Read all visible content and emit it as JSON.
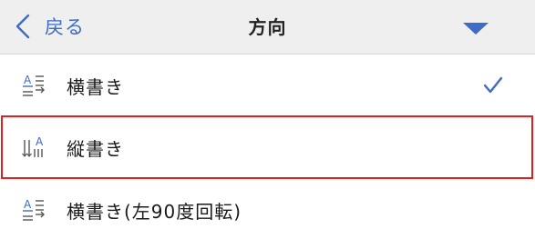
{
  "nav": {
    "back_label": "戻る",
    "title": "方向"
  },
  "options": [
    {
      "label": "横書き",
      "icon": "horizontal-text-icon",
      "checked": true
    },
    {
      "label": "縦書き",
      "icon": "vertical-text-icon",
      "checked": false,
      "highlighted": true
    },
    {
      "label": "横書き(左90度回転)",
      "icon": "horizontal-text-icon",
      "checked": false
    }
  ],
  "colors": {
    "accent": "#3d6bc6",
    "highlight_border": "#e0201f",
    "nav_background": "#efefef"
  }
}
